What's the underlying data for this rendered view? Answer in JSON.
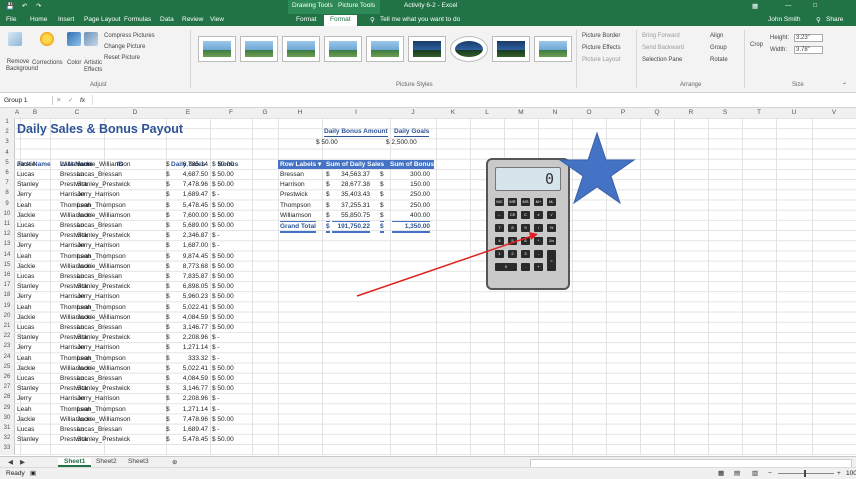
{
  "titlebar": {
    "app_icons": [
      "save-icon",
      "undo-icon",
      "redo-icon"
    ],
    "context_tabs": [
      "Drawing Tools",
      "Picture Tools"
    ],
    "doc_title": "Activity 6-2 - Excel",
    "user": "John Smith",
    "share": "Share"
  },
  "tabs": [
    "File",
    "Home",
    "Insert",
    "Page Layout",
    "Formulas",
    "Data",
    "Review",
    "View",
    "Format",
    "Format"
  ],
  "tell_me": "Tell me what you want to do",
  "ribbon": {
    "remove_bg": "Remove Background",
    "corrections": "Corrections",
    "color": "Color",
    "artistic": "Artistic Effects",
    "compress": "Compress Pictures",
    "change": "Change Picture",
    "reset": "Reset Picture",
    "adjust": "Adjust",
    "picture_styles": "Picture Styles",
    "border": "Picture Border",
    "effects": "Picture Effects",
    "layout": "Picture Layout",
    "bring_forward": "Bring Forward",
    "send_backward": "Send Backward",
    "selection_pane": "Selection Pane",
    "align": "Align",
    "group": "Group",
    "rotate": "Rotate",
    "arrange": "Arrange",
    "crop": "Crop",
    "height_label": "Height:",
    "height_val": "3.23\"",
    "width_label": "Width:",
    "width_val": "3.78\"",
    "size": "Size"
  },
  "namebox": "Group 1",
  "fx": "fx",
  "columns": [
    "A",
    "B",
    "C",
    "D",
    "E",
    "F",
    "G",
    "H",
    "I",
    "J",
    "K",
    "L",
    "M",
    "N",
    "O",
    "P",
    "Q",
    "R",
    "S",
    "T",
    "U",
    "V"
  ],
  "title": "Daily Sales & Bonus Payout",
  "headers": [
    "First Name",
    "Last Name",
    "ID",
    "Daily Sales",
    "Bonus"
  ],
  "rows": [
    [
      "Jackie",
      "Williamson",
      "Jackie_Williamson",
      "$",
      "6,785.14",
      "$ 50.00"
    ],
    [
      "Lucas",
      "Bressan",
      "Lucas_Bressan",
      "$",
      "4,687.50",
      "$ 50.00"
    ],
    [
      "Stanley",
      "Prestwick",
      "Stanley_Prestwick",
      "$",
      "7,478.96",
      "$ 50.00"
    ],
    [
      "Jerry",
      "Harrison",
      "Jerry_Harrison",
      "$",
      "1,689.47",
      "$   -"
    ],
    [
      "Leah",
      "Thompson",
      "Leah_Thompson",
      "$",
      "5,478.45",
      "$ 50.00"
    ],
    [
      "Jackie",
      "Williamson",
      "Jackie_Williamson",
      "$",
      "7,600.00",
      "$ 50.00"
    ],
    [
      "Lucas",
      "Bressan",
      "Lucas_Bressan",
      "$",
      "5,689.00",
      "$ 50.00"
    ],
    [
      "Stanley",
      "Prestwick",
      "Stanley_Prestwick",
      "$",
      "2,346.87",
      "$   -"
    ],
    [
      "Jerry",
      "Harrison",
      "Jerry_Harrison",
      "$",
      "1,687.00",
      "$   -"
    ],
    [
      "Leah",
      "Thompson",
      "Leah_Thompson",
      "$",
      "9,874.45",
      "$ 50.00"
    ],
    [
      "Jackie",
      "Williamson",
      "Jackie_Williamson",
      "$",
      "8,773.68",
      "$ 50.00"
    ],
    [
      "Lucas",
      "Bressan",
      "Lucas_Bressan",
      "$",
      "7,835.87",
      "$ 50.00"
    ],
    [
      "Stanley",
      "Prestwick",
      "Stanley_Prestwick",
      "$",
      "6,898.05",
      "$ 50.00"
    ],
    [
      "Jerry",
      "Harrison",
      "Jerry_Harrison",
      "$",
      "5,960.23",
      "$ 50.00"
    ],
    [
      "Leah",
      "Thompson",
      "Leah_Thompson",
      "$",
      "5,022.41",
      "$ 50.00"
    ],
    [
      "Jackie",
      "Williamson",
      "Jackie_Williamson",
      "$",
      "4,084.59",
      "$ 50.00"
    ],
    [
      "Lucas",
      "Bressan",
      "Lucas_Bressan",
      "$",
      "3,146.77",
      "$ 50.00"
    ],
    [
      "Stanley",
      "Prestwick",
      "Stanley_Prestwick",
      "$",
      "2,208.96",
      "$   -"
    ],
    [
      "Jerry",
      "Harrison",
      "Jerry_Harrison",
      "$",
      "1,271.14",
      "$   -"
    ],
    [
      "Leah",
      "Thompson",
      "Leah_Thompson",
      "$",
      "333.32",
      "$   -"
    ],
    [
      "Jackie",
      "Williamson",
      "Jackie_Williamson",
      "$",
      "5,022.41",
      "$ 50.00"
    ],
    [
      "Lucas",
      "Bressan",
      "Lucas_Bressan",
      "$",
      "4,084.59",
      "$ 50.00"
    ],
    [
      "Stanley",
      "Prestwick",
      "Stanley_Prestwick",
      "$",
      "3,146.77",
      "$ 50.00"
    ],
    [
      "Jerry",
      "Harrison",
      "Jerry_Harrison",
      "$",
      "2,208.96",
      "$   -"
    ],
    [
      "Leah",
      "Thompson",
      "Leah_Thompson",
      "$",
      "1,271.14",
      "$   -"
    ],
    [
      "Jackie",
      "Williamson",
      "Jackie_Williamson",
      "$",
      "7,478.96",
      "$ 50.00"
    ],
    [
      "Lucas",
      "Bressan",
      "Lucas_Bressan",
      "$",
      "1,689.47",
      "$   -"
    ],
    [
      "Stanley",
      "Prestwick",
      "Stanley_Prestwick",
      "$",
      "5,478.45",
      "$ 50.00"
    ]
  ],
  "bonus_box": {
    "h_label": "Daily Bonus Amount",
    "i_label": "Daily Goals",
    "h_val": "$          50.00",
    "i_val": "$   2,500.00"
  },
  "pivot": {
    "headers": [
      "Row Labels",
      "Sum of Daily Sales",
      "Sum of Bonus"
    ],
    "rows": [
      [
        "Bressan",
        "$",
        "34,563.37",
        "$",
        "300.00"
      ],
      [
        "Harrison",
        "$",
        "28,677.38",
        "$",
        "150.00"
      ],
      [
        "Prestwick",
        "$",
        "35,403.43",
        "$",
        "250.00"
      ],
      [
        "Thompson",
        "$",
        "37,255.31",
        "$",
        "250.00"
      ],
      [
        "Williamson",
        "$",
        "55,850.75",
        "$",
        "400.00"
      ]
    ],
    "total": [
      "Grand Total",
      "$",
      "191,750.22",
      "$",
      "1,350.00"
    ]
  },
  "calculator": {
    "display": "0",
    "keys": [
      "MC",
      "MR",
      "MS",
      "M+",
      "M-",
      "←",
      "CE",
      "C",
      "±",
      "√",
      "7",
      "8",
      "9",
      "/",
      "%",
      "4",
      "5",
      "6",
      "*",
      "1/x",
      "1",
      "2",
      "3",
      "-",
      "=",
      "0",
      ".",
      "+"
    ]
  },
  "sheets": [
    "Sheet1",
    "Sheet2",
    "Sheet3"
  ],
  "status_ready": "Ready",
  "zoom": "100%",
  "colors": {
    "excel_green": "#217346",
    "pivot_blue": "#4472c4",
    "star_blue": "#4472c4",
    "arrow_red": "#e02020"
  }
}
